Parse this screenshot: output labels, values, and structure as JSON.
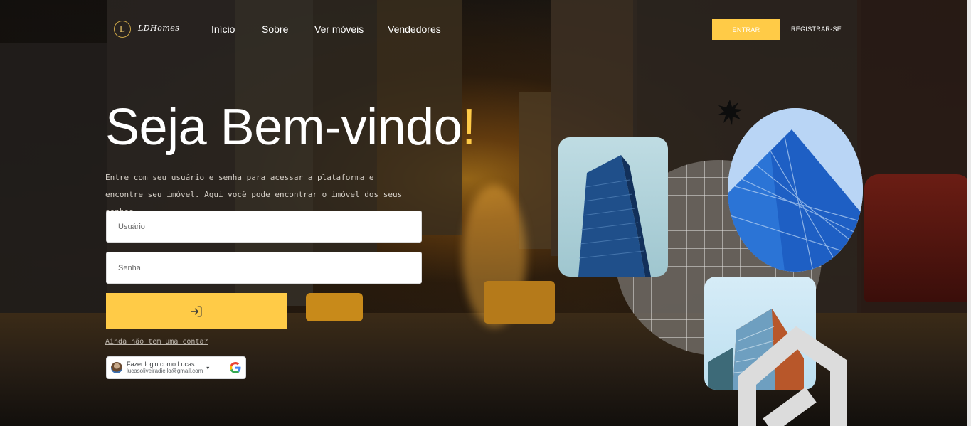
{
  "header": {
    "logo_mark": "L",
    "logo_text": "LDHomes",
    "nav": [
      "Início",
      "Sobre",
      "Ver móveis",
      "Vendedores"
    ],
    "login_button": "ENTRAR",
    "register_link": "REGISTRAR-SE"
  },
  "hero": {
    "title": "Seja Bem-vindo",
    "title_accent": "!",
    "description": "Entre com seu usuário e senha para acessar a plataforma e encontre seu imóvel. Aqui você pode encontrar o imóvel dos seus sonhos."
  },
  "form": {
    "username_placeholder": "Usuário",
    "password_placeholder": "Senha",
    "submit_icon": "login-icon",
    "signup_link": "Ainda não tem uma conta?"
  },
  "google_signin": {
    "label": "Fazer login como Lucas",
    "email": "lucasoliveiradiello@gmail.com"
  },
  "colors": {
    "accent": "#ffcb47",
    "text_light": "#ffffff"
  },
  "icons": [
    "logo-icon",
    "login-icon",
    "google-icon",
    "chevron-down-icon",
    "star-burst-icon",
    "house-outline-icon"
  ]
}
